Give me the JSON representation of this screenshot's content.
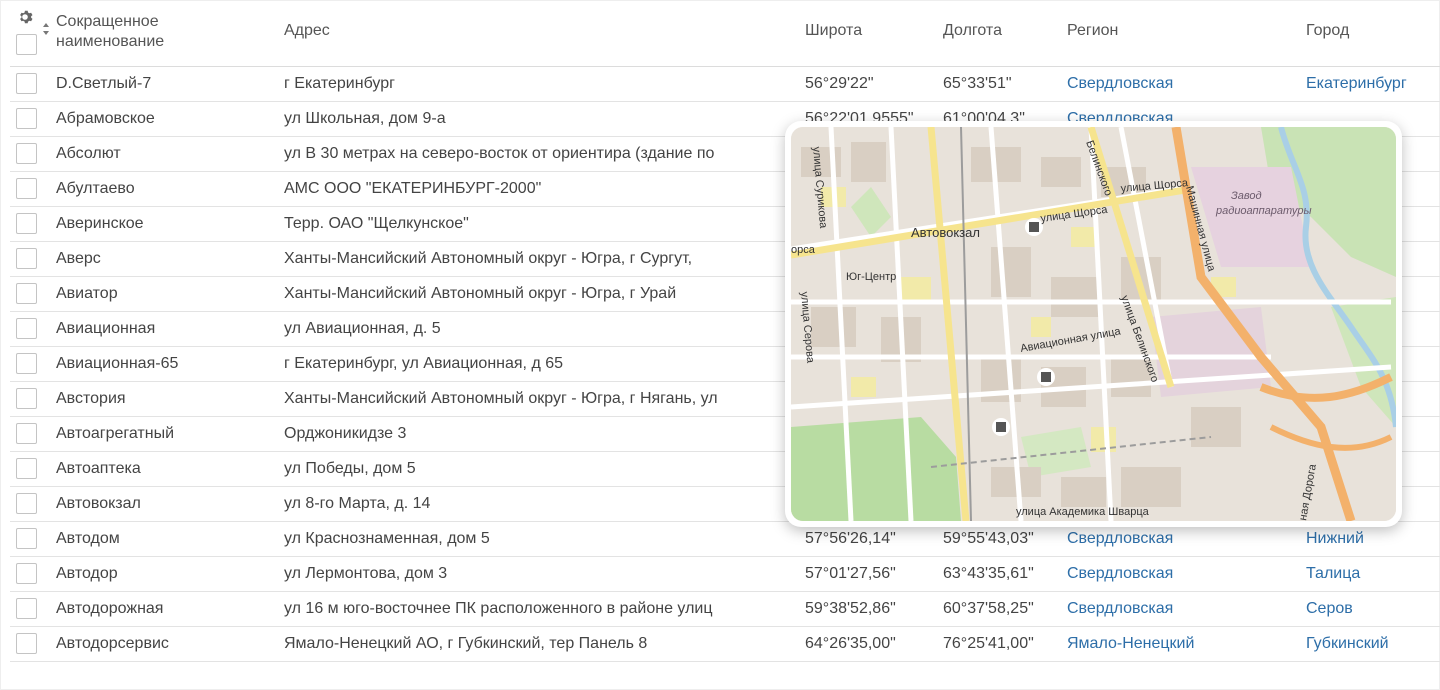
{
  "table": {
    "headers": {
      "name": "Сокращенное наименование",
      "address": "Адрес",
      "lat": "Широта",
      "lon": "Долгота",
      "region": "Регион",
      "city": "Город"
    },
    "rows": [
      {
        "name": "D.Светлый-7",
        "address": "г Екатеринбург",
        "lat": "56°29'22\"",
        "lon": "65°33'51\"",
        "region": "Свердловская",
        "city": "Екатеринбург"
      },
      {
        "name": "Абрамовское",
        "address": "ул Школьная, дом 9-а",
        "lat": "56°22'01,9555\"",
        "lon": "61°00'04,3\"",
        "region": "Свердловская",
        "city": ""
      },
      {
        "name": "Абсолют",
        "address": "ул В 30 метрах на северо-восток от ориентира (здание по",
        "lat": "",
        "lon": "",
        "region": "",
        "city": ""
      },
      {
        "name": "Абултаево",
        "address": "АМС ООО \"ЕКАТЕРИНБУРГ-2000\"",
        "lat": "",
        "lon": "",
        "region": "",
        "city": ""
      },
      {
        "name": "Аверинское",
        "address": "Терр. ОАО \"Щелкунское\"",
        "lat": "",
        "lon": "",
        "region": "",
        "city": ""
      },
      {
        "name": "Аверс",
        "address": "Ханты-Мансийский Автономный округ - Югра, г Сургут,",
        "lat": "",
        "lon": "",
        "region": "",
        "city": ""
      },
      {
        "name": "Авиатор",
        "address": "Ханты-Мансийский Автономный округ - Югра, г Урай",
        "lat": "",
        "lon": "",
        "region": "",
        "city": ""
      },
      {
        "name": "Авиационная",
        "address": "ул Авиационная, д. 5",
        "lat": "",
        "lon": "",
        "region": "",
        "city": "рг"
      },
      {
        "name": "Авиационная-65",
        "address": "г Екатеринбург, ул Авиационная, д 65",
        "lat": "",
        "lon": "",
        "region": "",
        "city": "рг"
      },
      {
        "name": "Австория",
        "address": "Ханты-Мансийский Автономный округ - Югра, г Нягань, ул",
        "lat": "",
        "lon": "",
        "region": "",
        "city": ""
      },
      {
        "name": "Автоагрегатный",
        "address": "Орджоникидзе 3",
        "lat": "",
        "lon": "",
        "region": "",
        "city": ""
      },
      {
        "name": "Автоаптека",
        "address": "ул Победы, дом 5",
        "lat": "",
        "lon": "",
        "region": "",
        "city": ""
      },
      {
        "name": "Автовокзал",
        "address": "ул 8-го Марта, д. 14",
        "lat": "",
        "lon": "",
        "region": "",
        "city": "рг"
      },
      {
        "name": "Автодом",
        "address": "ул Краснознаменная, дом 5",
        "lat": "57°56'26,14\"",
        "lon": "59°55'43,03\"",
        "region": "Свердловская",
        "city": "Нижний"
      },
      {
        "name": "Автодор",
        "address": "ул Лермонтова, дом 3",
        "lat": "57°01'27,56\"",
        "lon": "63°43'35,61\"",
        "region": "Свердловская",
        "city": "Талица"
      },
      {
        "name": "Автодорожная",
        "address": "ул 16 м юго-восточнее ПК расположенного в районе улиц",
        "lat": "59°38'52,86\"",
        "lon": "60°37'58,25\"",
        "region": "Свердловская",
        "city": "Серов"
      },
      {
        "name": "Автодорсервис",
        "address": "Ямало-Ненецкий АО, г Губкинский, тер Панель 8",
        "lat": "64°26'35,00\"",
        "lon": "76°25'41,00\"",
        "region": "Ямало-Ненецкий",
        "city": "Губкинский"
      }
    ]
  },
  "map_labels": {
    "shchorsa": "улица Щорса",
    "shchorsa2": "улица Щорса",
    "shchorsa_left": "орса",
    "avtovokzal": "Автовокзал",
    "yug_center": "Юг-Центр",
    "zavod": "Завод",
    "radio": "радиоаппаратуры",
    "aviation": "Авиационная улица",
    "mashinnaya": "Машинная улица",
    "belinskogo": "улица Белинского",
    "surikova": "улица Сурикова",
    "serova": "улица Серова",
    "shvarca": "улица Академика Шварца",
    "doroga": "ная Дорога",
    "bolshakova": "Белинского"
  },
  "colors": {
    "link": "#2d6ea8",
    "text": "#444444",
    "border": "#e3e3e3"
  },
  "icons": {
    "settings": "gear-icon",
    "sort": "sort-icon"
  }
}
